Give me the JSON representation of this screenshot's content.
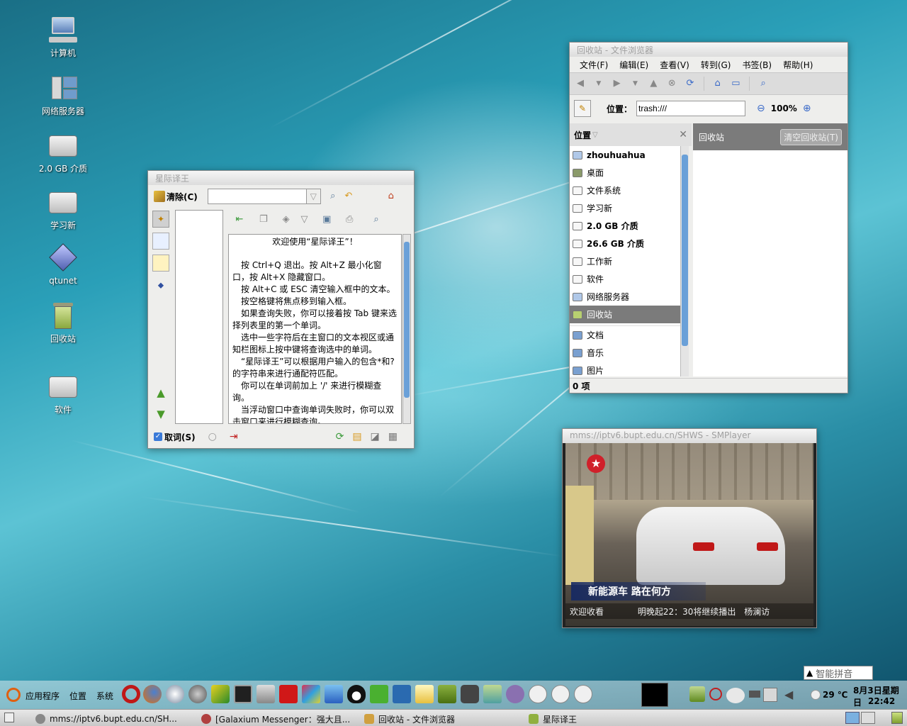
{
  "desktop": {
    "icons": [
      {
        "label": "计算机"
      },
      {
        "label": "网络服务器"
      },
      {
        "label": "2.0 GB 介质"
      },
      {
        "label": "学习新"
      },
      {
        "label": "qtunet"
      },
      {
        "label": "回收站"
      },
      {
        "label": "软件"
      }
    ]
  },
  "stardict": {
    "title": "星际译王",
    "clear_label": "清除(C)",
    "search_value": "",
    "welcome": "欢迎使用“星际译王”！",
    "lines": [
      "按 Ctrl+Q 退出。按 Alt+Z 最小化窗口，按 Alt+X 隐藏窗口。",
      "按 Alt+C 或 ESC 清空输入框中的文本。",
      "按空格键将焦点移到输入框。",
      "如果查询失败，你可以接着按 Tab 键来选择列表里的第一个单词。",
      "选中一些字符后在主窗口的文本视区或通知栏图标上按中键将查询选中的单词。",
      "“星际译王”可以根据用户输入的包含*和?的字符串来进行通配符匹配。",
      "你可以在单词前加上 '/' 来进行模糊查询。",
      "当浮动窗口中查询单词失败时，你可以双击窗口来进行模糊查询。"
    ],
    "scan_label": "取词(S)",
    "scan_checked": true
  },
  "filebrowser": {
    "title": "回收站 - 文件浏览器",
    "menus": [
      "文件(F)",
      "编辑(E)",
      "查看(V)",
      "转到(G)",
      "书签(B)",
      "帮助(H)"
    ],
    "location_label": "位置：",
    "location_value": "trash:///",
    "zoom": "100%",
    "sidebar_header": "位置",
    "places": [
      {
        "label": "zhouhuahua",
        "selected": false
      },
      {
        "label": "桌面",
        "selected": false
      },
      {
        "label": "文件系统",
        "selected": false
      },
      {
        "label": "学习新",
        "selected": false
      },
      {
        "label": "2.0 GB 介质",
        "selected": false
      },
      {
        "label": "26.6 GB 介质",
        "selected": false
      },
      {
        "label": "工作新",
        "selected": false
      },
      {
        "label": "软件",
        "selected": false
      },
      {
        "label": "网络服务器",
        "selected": false
      },
      {
        "label": "回收站",
        "selected": true
      }
    ],
    "bookmarks": [
      {
        "label": "文档"
      },
      {
        "label": "音乐"
      },
      {
        "label": "图片"
      }
    ],
    "content_title": "回收站",
    "empty_trash_label": "清空回收站(T)",
    "status": "0 项"
  },
  "smplayer": {
    "title": "mms://iptv6.bupt.edu.cn/SHWS - SMPlayer",
    "caption": "新能源车 路在何方",
    "ticker_left": "欢迎收看",
    "ticker_right": "明晚起22：30将继续播出",
    "logo_text": "杨澜访"
  },
  "ime": {
    "label": "智能拼音"
  },
  "top_panel": {
    "menus": [
      "应用程序",
      "位置",
      "系统"
    ],
    "weather": "29 ℃",
    "date": "8月3日星期日",
    "time": "22:42"
  },
  "bottom_panel": {
    "tasks": [
      {
        "label": "mms://iptv6.bupt.edu.cn/SH..."
      },
      {
        "label": "[Galaxium Messenger：强大且..."
      },
      {
        "label": "回收站 - 文件浏览器"
      },
      {
        "label": "星际译王"
      }
    ]
  }
}
